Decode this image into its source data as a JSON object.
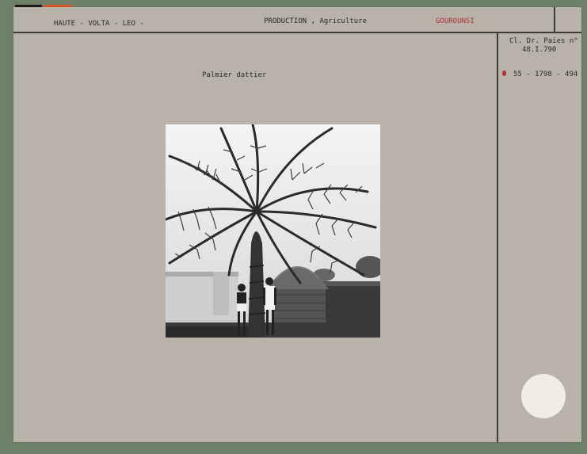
{
  "header": {
    "region": "HAUTE - VOLTA  -  LEO  -",
    "category": "PRODUCTION , Agriculture",
    "people": "GOUROUNSI"
  },
  "reference": {
    "line1": "Cl. Dr. Paies n°",
    "line2": "48.I.790",
    "inventory": "55 - 1798 - 494"
  },
  "caption": "Palmier dattier",
  "colors": {
    "card": "#b8b2a8",
    "background": "#6f8069",
    "accent_red": "#b0333c",
    "sticker_orange": "#e0542a",
    "sticker_black": "#1c1c1c",
    "sticker_white": "#f1ece4"
  },
  "photo": {
    "subject": "date-palm-photograph"
  }
}
